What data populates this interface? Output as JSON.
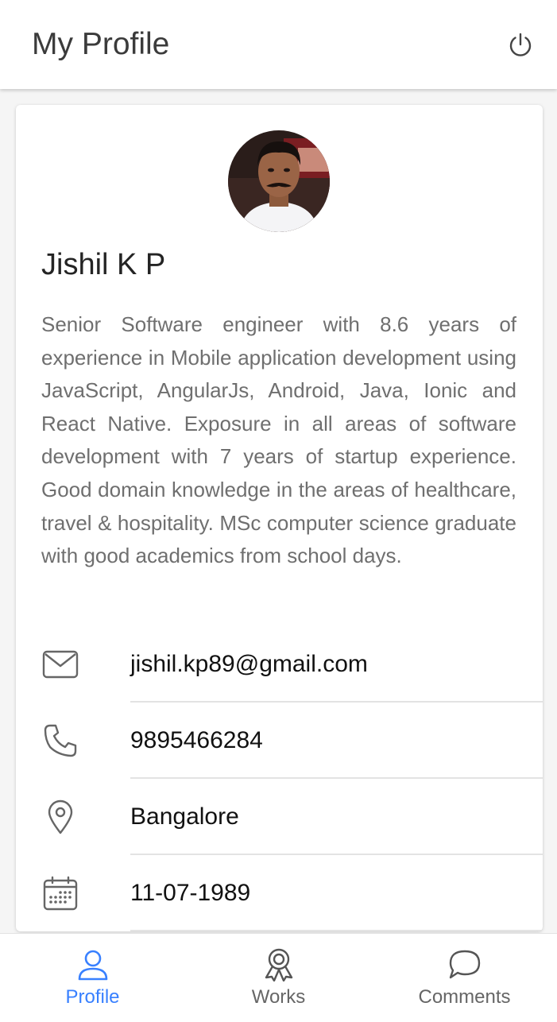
{
  "header": {
    "title": "My Profile",
    "power_icon": "power-icon"
  },
  "profile": {
    "avatar": "profile-photo",
    "name": "Jishil K P",
    "bio": "Senior Software engineer with 8.6 years of experience in Mobile application development using JavaScript, AngularJs, Android, Java, Ionic and React Native. Exposure in all areas of software development with 7 years of startup experience. Good domain knowledge in the areas of healthcare, travel & hospitality. MSc computer science graduate with good academics from school days.",
    "details": [
      {
        "icon": "mail-icon",
        "value": "jishil.kp89@gmail.com"
      },
      {
        "icon": "phone-icon",
        "value": "9895466284"
      },
      {
        "icon": "location-pin-icon",
        "value": "Bangalore"
      },
      {
        "icon": "calendar-icon",
        "value": "11-07-1989"
      }
    ]
  },
  "tabs": [
    {
      "label": "Profile",
      "icon": "person-icon",
      "active": true
    },
    {
      "label": "Works",
      "icon": "ribbon-icon",
      "active": false
    },
    {
      "label": "Comments",
      "icon": "chat-bubble-icon",
      "active": false
    }
  ],
  "colors": {
    "accent": "#3880ff",
    "inactive": "#666666",
    "background": "#f5f5f5"
  }
}
